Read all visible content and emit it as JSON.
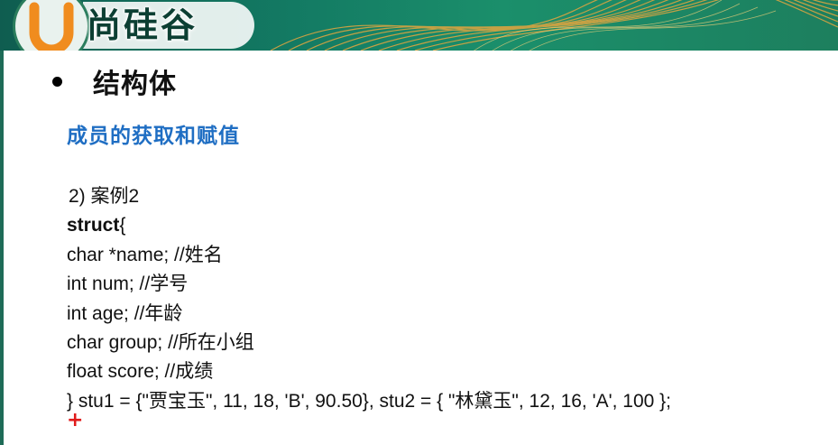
{
  "header": {
    "logo_letter": "U",
    "logo_text": "尚硅谷",
    "colors": {
      "band": "#137a63",
      "band_dark": "#0f5d50",
      "wave": "#d9a441",
      "logo_ring": "#2a7d5d"
    }
  },
  "slide": {
    "bullet_title": "结构体",
    "subtitle": "成员的获取和赋值",
    "subtitle_color": "#1f6ec3",
    "code_lines": [
      "2)  案例2",
      "struct{",
      "char *name; //姓名",
      "int num; //学号",
      "int age; //年龄",
      "char group; //所在小组",
      "float score; //成绩",
      "} stu1 = {\"贾宝玉\", 11, 18, 'B', 90.50}, stu2 = { \"林黛玉\", 12, 16, 'A', 100 };"
    ],
    "struct_keyword": "struct",
    "struct_brace": "{",
    "cursor_marker": "+",
    "cursor_color": "#e01b1b"
  }
}
